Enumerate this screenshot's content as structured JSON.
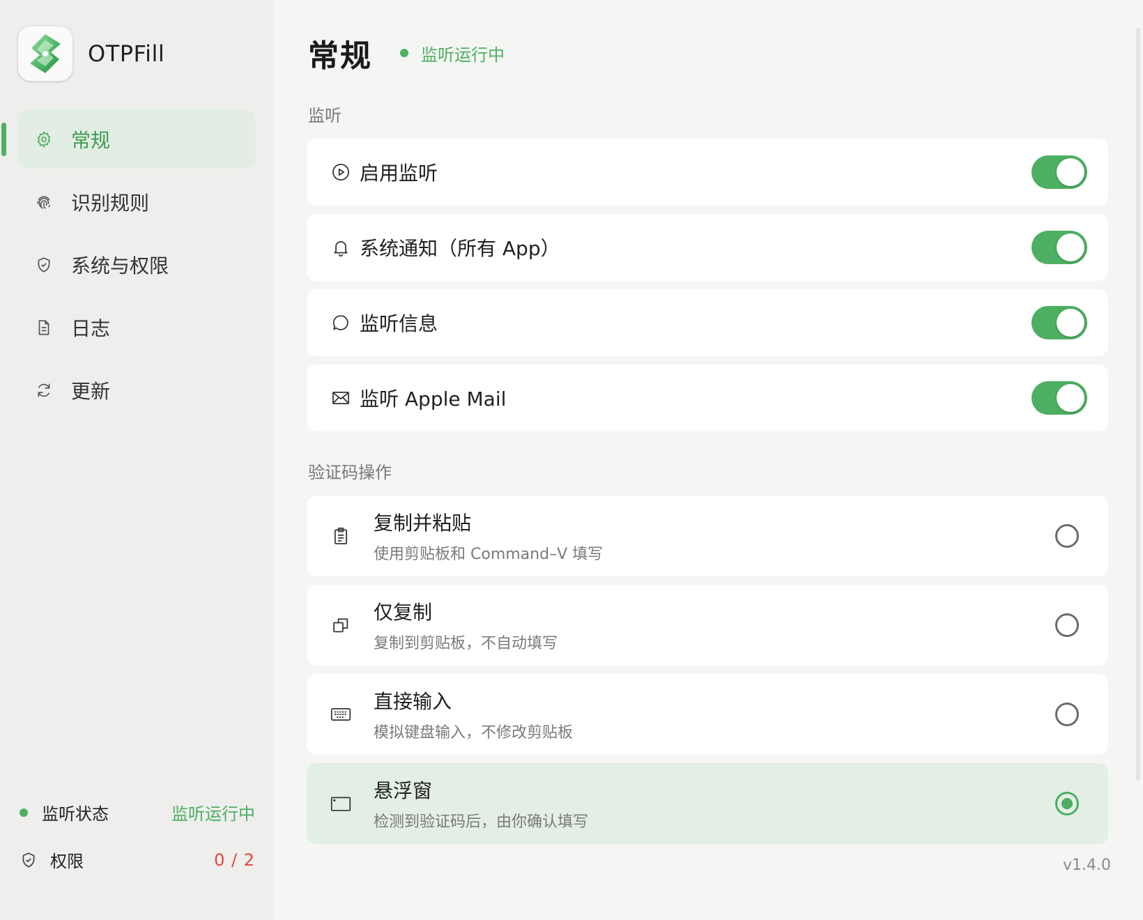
{
  "app": {
    "name": "OTPFill"
  },
  "sidebar": {
    "items": [
      {
        "label": "常规",
        "icon": "gear-icon",
        "active": true
      },
      {
        "label": "识别规则",
        "icon": "fingerprint-icon",
        "active": false
      },
      {
        "label": "系统与权限",
        "icon": "shield-icon",
        "active": false
      },
      {
        "label": "日志",
        "icon": "document-icon",
        "active": false
      },
      {
        "label": "更新",
        "icon": "refresh-icon",
        "active": false
      }
    ],
    "status": {
      "label": "监听状态",
      "value": "监听运行中"
    },
    "permissions": {
      "label": "权限",
      "value": "0 / 2"
    }
  },
  "header": {
    "title": "常规",
    "status": "监听运行中"
  },
  "sections": {
    "listen": {
      "title": "监听",
      "items": [
        {
          "label": "启用监听",
          "icon": "play-circle-icon",
          "enabled": true
        },
        {
          "label": "系统通知（所有 App）",
          "icon": "bell-icon",
          "enabled": true
        },
        {
          "label": "监听信息",
          "icon": "message-bubble-icon",
          "enabled": true
        },
        {
          "label": "监听 Apple Mail",
          "icon": "mail-icon",
          "enabled": true
        }
      ]
    },
    "code_action": {
      "title": "验证码操作",
      "options": [
        {
          "title": "复制并粘贴",
          "desc": "使用剪贴板和 Command–V 填写",
          "icon": "clipboard-icon",
          "selected": false
        },
        {
          "title": "仅复制",
          "desc": "复制到剪贴板，不自动填写",
          "icon": "copy-icon",
          "selected": false
        },
        {
          "title": "直接输入",
          "desc": "模拟键盘输入，不修改剪贴板",
          "icon": "keyboard-icon",
          "selected": false
        },
        {
          "title": "悬浮窗",
          "desc": "检测到验证码后，由你确认填写",
          "icon": "window-icon",
          "selected": true
        }
      ]
    }
  },
  "version": "v1.4.0",
  "colors": {
    "accent": "#4caf61",
    "danger": "#e0483e",
    "selected_bg": "#e3eee4"
  }
}
